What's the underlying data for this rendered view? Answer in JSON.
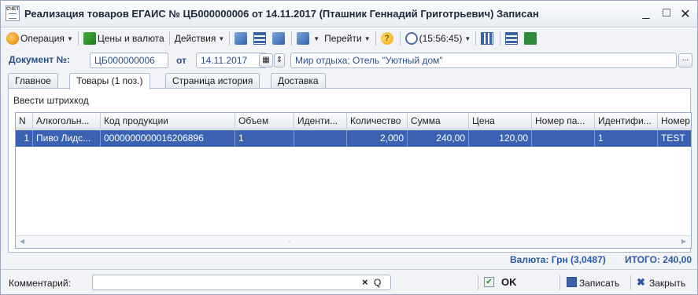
{
  "window": {
    "icon_text": "СЧЕТ",
    "title": "Реализация товаров ЕГАИС № ЦБ000000006 от 14.11.2017 (Пташник Геннадий Григотрьевич) Записан",
    "minimize": "_",
    "maximize": "□",
    "close": "✕"
  },
  "toolbar": {
    "operation_label": "Операция",
    "prices_label": "Цены и валюта",
    "actions_label": "Действия",
    "goto_label": "Перейти",
    "help_label": "?",
    "time_label": "(15:56:45)"
  },
  "doc": {
    "number_label": "Документ №:",
    "number_value": "ЦБ000000006",
    "date_label": "от",
    "date_value": "14.11.2017",
    "org_value": "Мир отдыха; Отель \"Уютный дом\"",
    "more_button": "..."
  },
  "tabs": [
    {
      "label": "Главное"
    },
    {
      "label": "Товары (1 поз.)"
    },
    {
      "label": "Страница история"
    },
    {
      "label": "Доставка"
    }
  ],
  "barcode_link": "Ввести штрихкод",
  "table": {
    "columns": [
      "N",
      "Алкогольн...",
      "Код продукции",
      "Объем",
      "Иденти...",
      "Количество",
      "Сумма",
      "Цена",
      "Номер па...",
      "Идентифи...",
      "Номер"
    ],
    "rows": [
      [
        "1",
        "Пиво Лидс...",
        "0000000000016206896",
        "1",
        "",
        "2,000",
        "240,00",
        "120,00",
        "",
        "1",
        "TEST"
      ]
    ]
  },
  "totals": {
    "currency": "Валюта: Грн (3,0487)",
    "total": "ИТОГО: 240,00"
  },
  "bottom": {
    "comment_label": "Комментарий:",
    "comment_value": "",
    "clear_icon": "×",
    "search_icon": "Q",
    "ok_label": "OK",
    "save_label": "Записать",
    "close_label": "Закрыть"
  },
  "colors": {
    "selection": "#3a62b0",
    "accent_text": "#2a4f8a",
    "total_text": "#2a5aa8"
  }
}
